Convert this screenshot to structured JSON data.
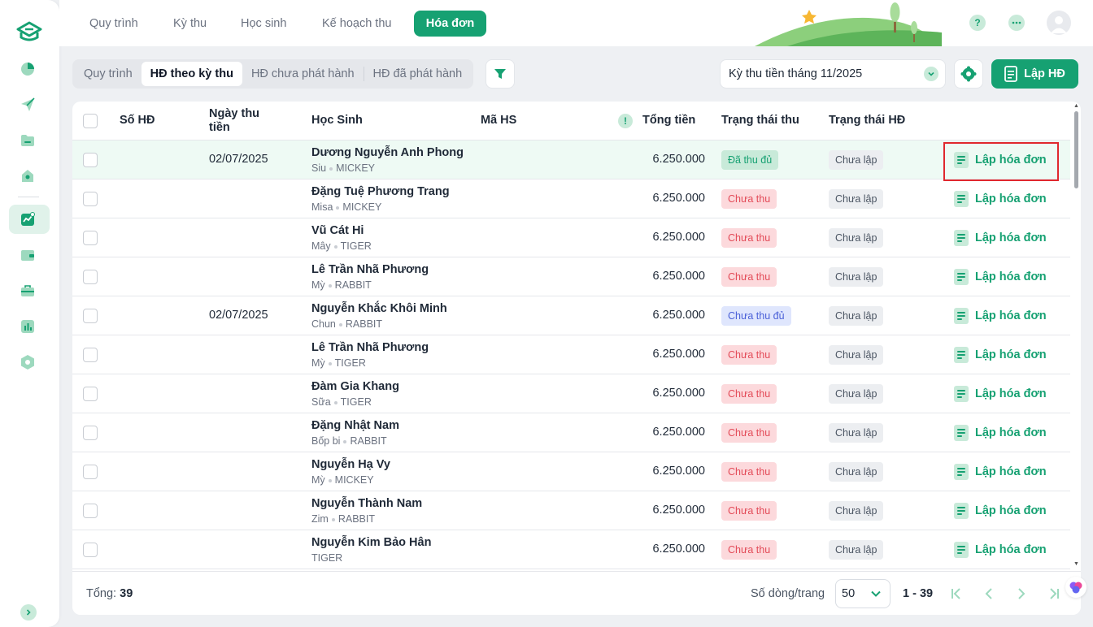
{
  "nav": {
    "tabs": [
      "Quy trình",
      "Kỳ thu",
      "Học sinh",
      "Kế hoạch thu",
      "Hóa đơn"
    ],
    "active_tab": "Hóa đơn"
  },
  "toolbar": {
    "segments": [
      "Quy trình",
      "HĐ theo kỳ thu",
      "HĐ chưa phát hành",
      "HĐ đã phát hành"
    ],
    "active_segment": "HĐ theo kỳ thu",
    "period": "Kỳ thu tiền tháng 11/2025",
    "create_label": "Lập HĐ"
  },
  "table": {
    "headers": {
      "invoice_no": "Số HĐ",
      "date": "Ngày thu tiền",
      "student": "Học Sinh",
      "code": "Mã HS",
      "total": "Tổng tiền",
      "collect_status": "Trạng thái thu",
      "invoice_status": "Trạng thái HĐ"
    },
    "action_label": "Lập hóa đơn",
    "rows": [
      {
        "date": "02/07/2025",
        "name": "Dương Nguyễn Anh Phong",
        "nick": "Siu",
        "cls": "MICKEY",
        "total": "6.250.000",
        "collect": "Đã thu đủ",
        "ctype": "done",
        "invoice": "Chưa lập"
      },
      {
        "date": "",
        "name": "Đặng Tuệ Phương Trang",
        "nick": "Misa",
        "cls": "MICKEY",
        "total": "6.250.000",
        "collect": "Chưa thu",
        "ctype": "none",
        "invoice": "Chưa lập"
      },
      {
        "date": "",
        "name": "Vũ Cát Hi",
        "nick": "Mây",
        "cls": "TIGER",
        "total": "6.250.000",
        "collect": "Chưa thu",
        "ctype": "none",
        "invoice": "Chưa lập"
      },
      {
        "date": "",
        "name": "Lê Trần Nhã Phương",
        "nick": "Mỳ",
        "cls": "RABBIT",
        "total": "6.250.000",
        "collect": "Chưa thu",
        "ctype": "none",
        "invoice": "Chưa lập"
      },
      {
        "date": "02/07/2025",
        "name": "Nguyễn Khắc Khôi Minh",
        "nick": "Chun",
        "cls": "RABBIT",
        "total": "6.250.000",
        "collect": "Chưa thu đủ",
        "ctype": "partial",
        "invoice": "Chưa lập"
      },
      {
        "date": "",
        "name": "Lê Trần Nhã Phương",
        "nick": "Mỳ",
        "cls": "TIGER",
        "total": "6.250.000",
        "collect": "Chưa thu",
        "ctype": "none",
        "invoice": "Chưa lập"
      },
      {
        "date": "",
        "name": "Đàm Gia Khang",
        "nick": "Sữa",
        "cls": "TIGER",
        "total": "6.250.000",
        "collect": "Chưa thu",
        "ctype": "none",
        "invoice": "Chưa lập"
      },
      {
        "date": "",
        "name": "Đặng Nhật Nam",
        "nick": "Bốp bi",
        "cls": "RABBIT",
        "total": "6.250.000",
        "collect": "Chưa thu",
        "ctype": "none",
        "invoice": "Chưa lập"
      },
      {
        "date": "",
        "name": "Nguyễn Hạ Vy",
        "nick": "Mỳ",
        "cls": "MICKEY",
        "total": "6.250.000",
        "collect": "Chưa thu",
        "ctype": "none",
        "invoice": "Chưa lập"
      },
      {
        "date": "",
        "name": "Nguyễn Thành Nam",
        "nick": "Zim",
        "cls": "RABBIT",
        "total": "6.250.000",
        "collect": "Chưa thu",
        "ctype": "none",
        "invoice": "Chưa lập"
      },
      {
        "date": "",
        "name": "Nguyễn Kim Bảo Hân",
        "nick": "",
        "cls": "TIGER",
        "total": "6.250.000",
        "collect": "Chưa thu",
        "ctype": "none",
        "invoice": "Chưa lập"
      }
    ]
  },
  "footer": {
    "total_label": "Tổng:",
    "total_count": "39",
    "rows_per_page_label": "Số dòng/trang",
    "rows_per_page": "50",
    "range": "1 - 39"
  },
  "colors": {
    "accent": "#16a172",
    "accent_soft": "#c8ead9",
    "danger": "#e34b58",
    "focus": "#e0282e"
  }
}
